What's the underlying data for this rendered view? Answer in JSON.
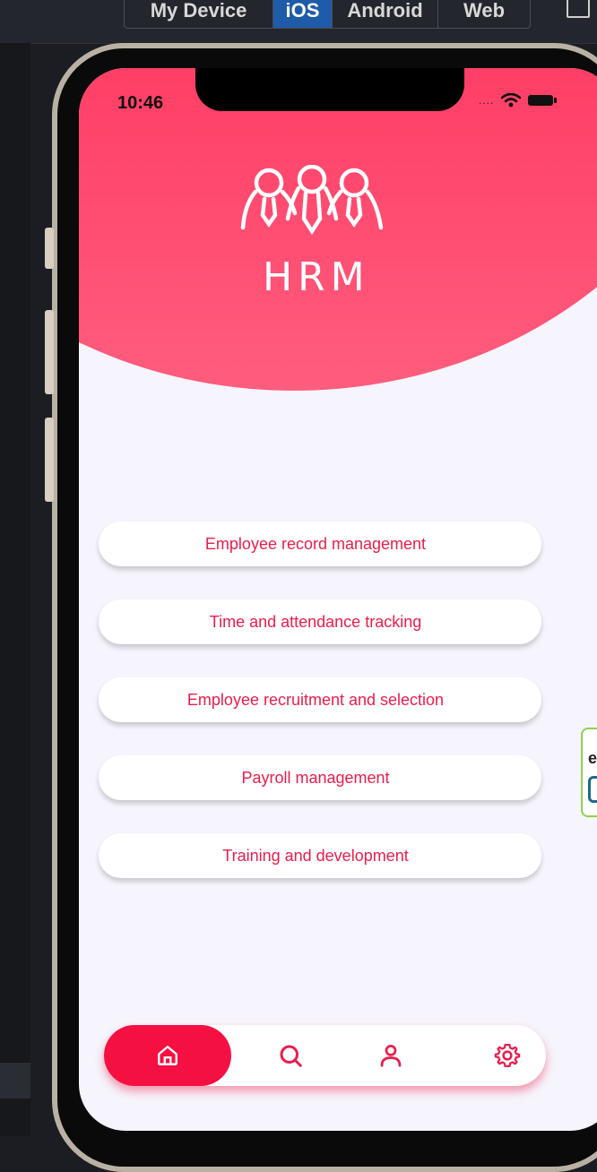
{
  "toolbar": {
    "device_tabs": [
      {
        "label": "My Device"
      },
      {
        "label": "iOS",
        "active": true
      },
      {
        "label": "Android"
      },
      {
        "label": "Web"
      }
    ]
  },
  "status_bar": {
    "time": "10:46",
    "signal": "....",
    "icons": [
      "wifi-icon",
      "battery-icon"
    ]
  },
  "app": {
    "logo_text": "HRM",
    "logo_icon": "team-people-icon",
    "header_color": "#ff3f66",
    "accent_color": "#ea1d4c",
    "menu": [
      {
        "label": "Employee record management"
      },
      {
        "label": "Time and attendance tracking"
      },
      {
        "label": "Employee recruitment and selection"
      },
      {
        "label": "Payroll management"
      },
      {
        "label": "Training and development"
      }
    ],
    "tabbar": [
      {
        "icon": "home-icon",
        "active": true
      },
      {
        "icon": "search-icon",
        "active": false
      },
      {
        "icon": "user-icon",
        "active": false
      },
      {
        "icon": "gear-icon",
        "active": false
      }
    ]
  }
}
